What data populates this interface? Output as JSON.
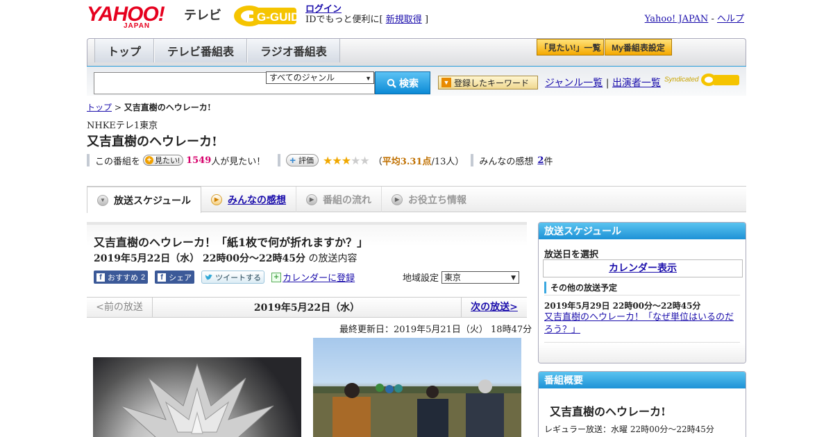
{
  "header": {
    "yahoo_logo": "YAHOO!",
    "yahoo_sub": "JAPAN",
    "tv_label": "テレビ",
    "gguide_logo": "G-GUIDE",
    "login_link": "ログイン",
    "login_text": "IDでもっと便利に[",
    "signup_link": "新規取得",
    "login_close": "]",
    "yahoo_japan_link": "Yahoo! JAPAN",
    "dash": "-",
    "help_link": "ヘルプ"
  },
  "nav": {
    "tabs": [
      "トップ",
      "テレビ番組表",
      "ラジオ番組表"
    ],
    "want_list": "「見たい!」一覧",
    "my_schedule": "My番組表設定"
  },
  "search": {
    "input_value": "",
    "genre_selected": "すべてのジャンル",
    "search_button": "検索",
    "keyword_button": "登録したキーワード",
    "genre_list": "ジャンル一覧",
    "pipe": "|",
    "cast_list": "出演者一覧",
    "syndicated": "Syndicated"
  },
  "breadcrumb": {
    "top": "トップ",
    "separator": ">",
    "current": "又吉直樹のヘウレーカ!"
  },
  "program": {
    "channel": "NHKEテレ1東京",
    "title": "又吉直樹のヘウレーカ!",
    "want_prefix": "この番組を",
    "want_button": "見たい!",
    "want_count": "1549",
    "want_suffix": "人が見たい！",
    "rate_button": "評価",
    "rating": 3,
    "rating_max": 5,
    "avg_open": "（",
    "avg_text": "平均3.31点",
    "avg_count": "/13人）",
    "impressions_label": "みんなの感想",
    "impressions_count": "2",
    "impressions_unit": "件"
  },
  "subtabs": [
    {
      "label": "放送スケジュール",
      "state": "active"
    },
    {
      "label": "みんなの感想",
      "state": "link"
    },
    {
      "label": "番組の流れ",
      "state": "disabled"
    },
    {
      "label": "お役立ち情報",
      "state": "disabled"
    }
  ],
  "episode": {
    "title": "又吉直樹のヘウレーカ！「紙1枚で何が折れますか？」",
    "date_bold": "2019年5月22日（水） 22時00分～22時45分",
    "date_suffix": "の放送内容",
    "fb_recommend": "おすすめ",
    "fb_count": "2",
    "fb_share": "シェア",
    "tweet": "ツイートする",
    "calendar": "カレンダーに登録",
    "region_label": "地域設定",
    "region_value": "東京"
  },
  "pager": {
    "prev": "<前の放送",
    "current": "2019年5月22日（水）",
    "next": "次の放送>"
  },
  "updated": "最終更新日：2019年5月21日（火） 18時47分",
  "sidebar": {
    "schedule_head": "放送スケジュール",
    "select_day": "放送日を選択",
    "calendar_btn": "カレンダー表示",
    "other_head": "その他の放送予定",
    "other_date": "2019年5月29日 22時00分～22時45分",
    "other_title": "又吉直樹のヘウレーカ！「なぜ単位はいるのだろう？」",
    "summary_head": "番組概要",
    "summary_title": "又吉直樹のヘウレーカ!",
    "regular": "レギュラー放送：水曜 22時00分～22時45分"
  },
  "colors": {
    "accent_blue": "#1e92d6",
    "yahoo_red": "#e6001e",
    "gguide_yellow": "#f5c400",
    "want_pink": "#d6006b",
    "star_orange": "#f0a800"
  }
}
